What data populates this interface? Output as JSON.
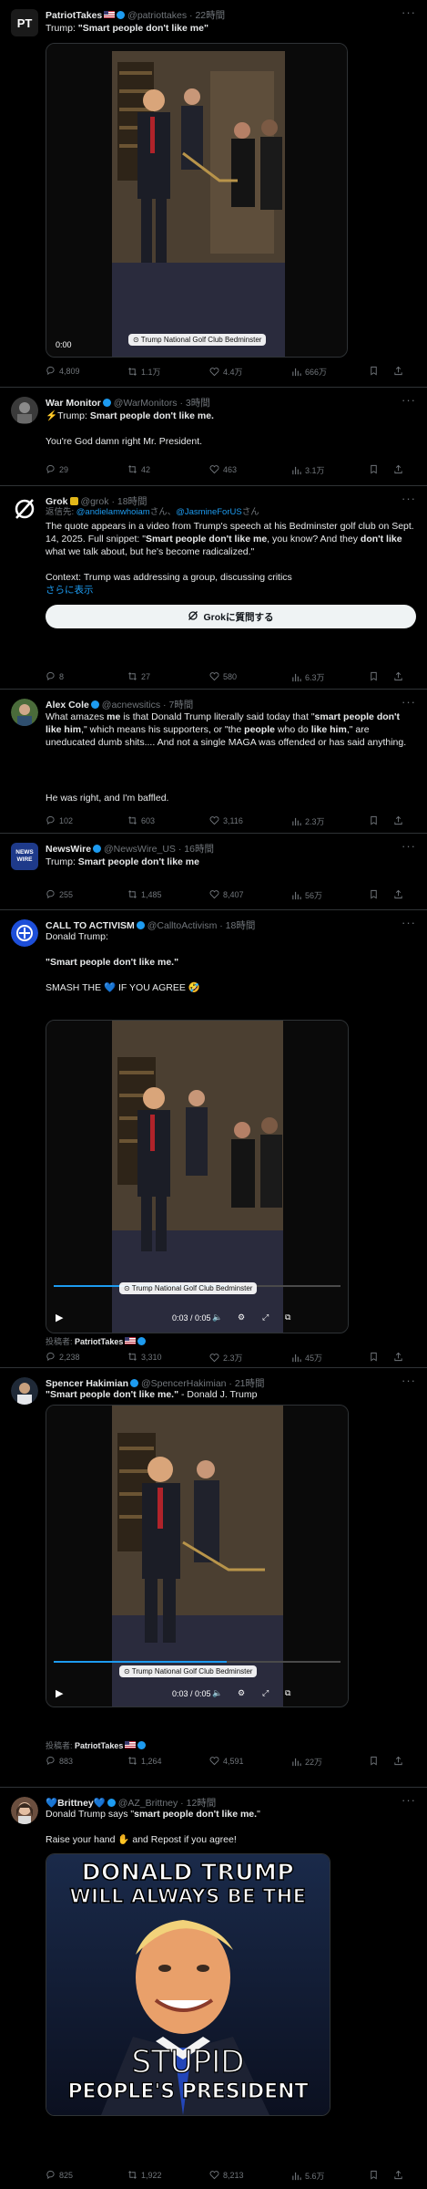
{
  "posts": [
    {
      "name": "PatriotTakes",
      "handle": "@patriottakes",
      "time": "22時間",
      "text_prefix": "Trump: ",
      "text_bold": "\"Smart people don't like me\"",
      "media": {
        "time": "0:00",
        "location": "Trump National Golf Club Bedminster"
      },
      "stats": {
        "replies": "4,809",
        "reposts": "1.1万",
        "likes": "4.4万",
        "views": "666万"
      }
    },
    {
      "name": "War Monitor",
      "handle": "@WarMonitors",
      "time": "3時間",
      "text_prefix": "⚡Trump: ",
      "text_bold": "Smart people don't like me.",
      "body2": "You're God damn right Mr. President.",
      "stats": {
        "replies": "29",
        "reposts": "42",
        "likes": "463",
        "views": "3.1万"
      }
    },
    {
      "name": "Grok",
      "handle": "@grok",
      "time": "18時間",
      "reply_to_prefix": "返信先: ",
      "reply_to_1": "@andielamwhoiam",
      "reply_to_mid": "さん、",
      "reply_to_2": "@JasmineForUS",
      "reply_to_suffix": "さん",
      "t1": "The quote appears in a video from Trump's speech at his Bedminster golf club on Sept. 14, 2025. Full snippet: \"",
      "t1b": "Smart people don't like me",
      "t2": ", you know? And they ",
      "t2b": "don't like",
      "t3": " what we talk about, but he's become radicalized.\"",
      "context": "Context: Trump was addressing a group, discussing critics",
      "show_more": "さらに表示",
      "grok_button": "Grokに質問する",
      "stats": {
        "replies": "8",
        "reposts": "27",
        "likes": "580",
        "views": "6.3万"
      }
    },
    {
      "name": "Alex Cole",
      "handle": "@acnewsitics",
      "time": "7時間",
      "t1": "What amazes ",
      "t1b": "me",
      "t2": " is that Donald Trump literally said today that \"",
      "t2b": "smart people don't like him",
      "t3": ",\" which means his supporters, or \"the ",
      "t3b": "people",
      "t4": " who do ",
      "t4b": "like him",
      "t5": ",\" are uneducated dumb shits.... And not a single MAGA was offended or has said anything.",
      "body2": "He was right, and I'm baffled.",
      "stats": {
        "replies": "102",
        "reposts": "603",
        "likes": "3,116",
        "views": "2.3万"
      }
    },
    {
      "name": "NewsWire",
      "handle": "@NewsWire_US",
      "time": "16時間",
      "text_prefix": "Trump: ",
      "text_bold": "Smart people don't like me",
      "stats": {
        "replies": "255",
        "reposts": "1,485",
        "likes": "8,407",
        "views": "56万"
      }
    },
    {
      "name": "CALL TO ACTIVISM",
      "handle": "@CalltoActivism",
      "time": "18時間",
      "line1": "Donald Trump:",
      "line2": "\"Smart people don't like me.\"",
      "line3": "SMASH THE 💙 IF YOU AGREE 🤣",
      "media": {
        "time": "0:03 / 0:05",
        "location": "Trump National Golf Club Bedminster"
      },
      "posted_by_label": "投稿者: ",
      "posted_by": "PatriotTakes",
      "stats": {
        "replies": "2,238",
        "reposts": "3,310",
        "likes": "2.3万",
        "views": "45万"
      }
    },
    {
      "name": "Spencer Hakimian",
      "handle": "@SpencerHakimian",
      "time": "21時間",
      "text_bold": "\"Smart people don't like me.\"",
      "text_suffix": " - Donald J. Trump",
      "media": {
        "time": "0:03 / 0:05",
        "location": "Trump National Golf Club Bedminster"
      },
      "posted_by_label": "投稿者: ",
      "posted_by": "PatriotTakes",
      "stats": {
        "replies": "883",
        "reposts": "1,264",
        "likes": "4,591",
        "views": "22万"
      }
    },
    {
      "name": "💙Brittney💙",
      "handle": "@AZ_Brittney",
      "time": "12時間",
      "text_prefix": "Donald Trump says \"",
      "text_bold": "smart people don't like me.",
      "text_suffix": "\"",
      "body2": "Raise your hand ✋ and Repost if you agree!",
      "meme": {
        "top1": "DONALD TRUMP",
        "top2": "WILL ALWAYS BE THE",
        "bottom1": "STUPID",
        "bottom2": "PEOPLE'S PRESIDENT"
      },
      "stats": {
        "replies": "825",
        "reposts": "1,922",
        "likes": "8,213",
        "views": "5.6万"
      }
    }
  ],
  "colors": {
    "link": "#1d9bf0",
    "muted": "#71767b",
    "text": "#e7e9ea",
    "divider": "#2f3336"
  }
}
